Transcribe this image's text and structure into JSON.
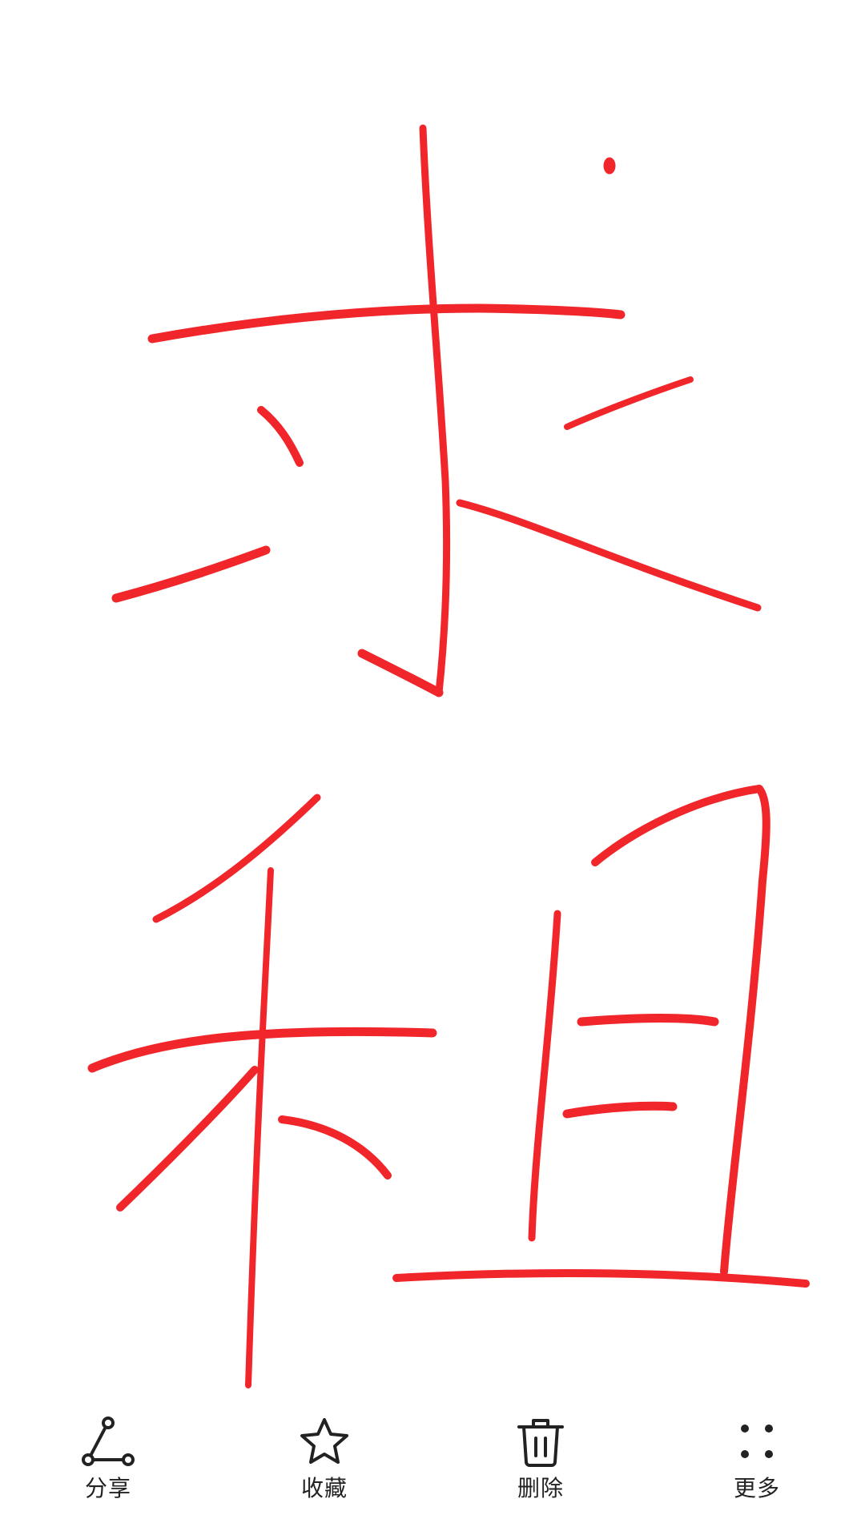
{
  "drawing": {
    "ink_color": "#f0262a",
    "characters": [
      "求",
      "租"
    ]
  },
  "toolbar": {
    "items": [
      {
        "label": "分享",
        "icon": "share-icon"
      },
      {
        "label": "收藏",
        "icon": "star-icon"
      },
      {
        "label": "删除",
        "icon": "trash-icon"
      },
      {
        "label": "更多",
        "icon": "more-dots-icon"
      }
    ],
    "icon_color": "#222222"
  }
}
